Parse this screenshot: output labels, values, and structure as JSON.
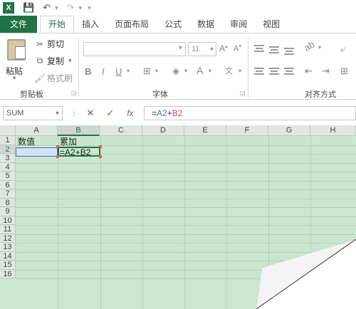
{
  "qat": {
    "app_icon": "X",
    "save_icon": "save-icon",
    "undo_icon": "undo-icon",
    "redo_icon": "redo-icon"
  },
  "tabs": [
    {
      "label": "文件"
    },
    {
      "label": "开始"
    },
    {
      "label": "插入"
    },
    {
      "label": "页面布局"
    },
    {
      "label": "公式"
    },
    {
      "label": "数据"
    },
    {
      "label": "审阅"
    },
    {
      "label": "视图"
    }
  ],
  "ribbon": {
    "clipboard": {
      "paste": "粘贴",
      "cut": "剪切",
      "copy": "复制",
      "format_painter": "格式刷",
      "group_label": "剪贴板"
    },
    "font": {
      "font_name": "",
      "font_size": "11",
      "group_label": "字体"
    },
    "alignment": {
      "group_label": "对齐方式"
    }
  },
  "formula_bar": {
    "name_box": "SUM",
    "formula_prefix": "=",
    "formula_ref_a": "A2",
    "formula_op": "+",
    "formula_ref_b": "B2"
  },
  "sheet": {
    "columns": [
      "A",
      "B",
      "C",
      "D",
      "E",
      "F",
      "G",
      "H"
    ],
    "rows": [
      "1",
      "2",
      "3",
      "4",
      "5",
      "6",
      "7",
      "8",
      "9",
      "10",
      "11",
      "12",
      "13",
      "14",
      "15",
      "16"
    ],
    "cells": {
      "A1": "数值",
      "B1": "累加",
      "B2": "=A2+B2"
    }
  },
  "colors": {
    "accent": "#217346",
    "grid_bg": "#c9e7cf",
    "ref_a": "#4472c4",
    "ref_b": "#c0504d"
  }
}
